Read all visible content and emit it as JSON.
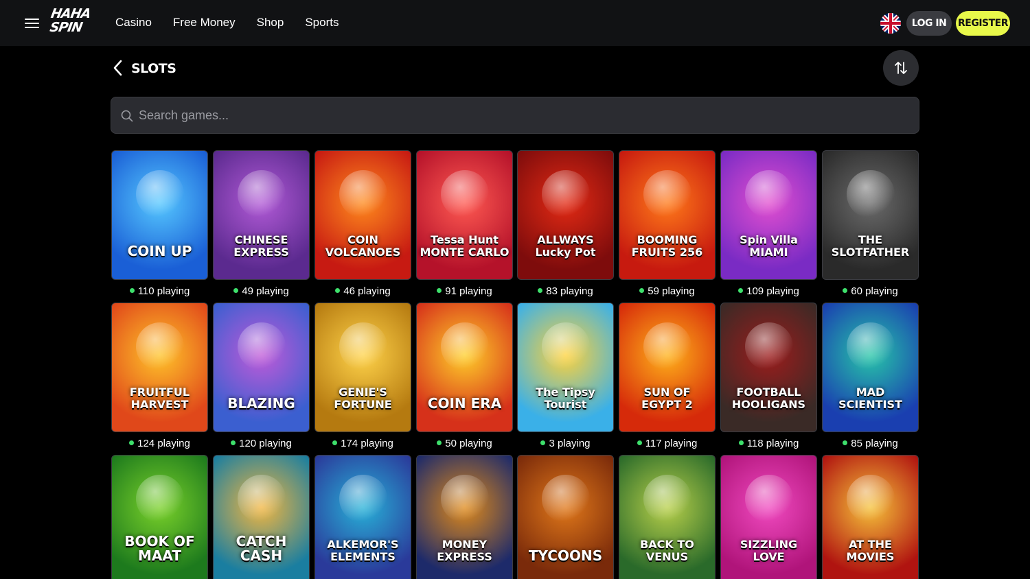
{
  "header": {
    "logo_line1": "HAHA",
    "logo_line2": "SPIN",
    "nav": [
      "Casino",
      "Free Money",
      "Shop",
      "Sports"
    ],
    "login_label": "LOG IN",
    "register_label": "REGISTER"
  },
  "page": {
    "title": "SLOTS"
  },
  "search": {
    "placeholder": "Search games..."
  },
  "games": [
    {
      "title": "COIN UP",
      "playing": "110 playing",
      "bg": "#1a5fd6",
      "bg2": "#56c8ff",
      "icon": "coin-up-thumb"
    },
    {
      "title": "CHINESE EXPRESS",
      "playing": "49 playing",
      "bg": "#5b2a8f",
      "bg2": "#b15ad6",
      "icon": "chinese-express-thumb"
    },
    {
      "title": "COIN VOLCANOES",
      "playing": "46 playing",
      "bg": "#c71a12",
      "bg2": "#ff8a1d",
      "icon": "coin-volcanoes-thumb"
    },
    {
      "title": "Tessa Hunt MONTE CARLO",
      "playing": "91 playing",
      "bg": "#b5122a",
      "bg2": "#ff5a52",
      "icon": "monte-carlo-thumb"
    },
    {
      "title": "ALLWAYS Lucky Pot",
      "playing": "83 playing",
      "bg": "#7e0c0c",
      "bg2": "#e32a14",
      "icon": "allways-lucky-pot-thumb"
    },
    {
      "title": "BOOMING FRUITS 256",
      "playing": "59 playing",
      "bg": "#c71a0f",
      "bg2": "#ff7a1a",
      "icon": "booming-fruits-thumb"
    },
    {
      "title": "Spin Villa MIAMI",
      "playing": "109 playing",
      "bg": "#7a2bc4",
      "bg2": "#e24fd0",
      "icon": "spin-villa-thumb"
    },
    {
      "title": "THE SLOTFATHER",
      "playing": "60 playing",
      "bg": "#2a2a2a",
      "bg2": "#6b6b6b",
      "icon": "slotfather-thumb"
    },
    {
      "title": "FRUITFUL HARVEST",
      "playing": "124 playing",
      "bg": "#e0481a",
      "bg2": "#ffc42a",
      "icon": "fruitful-harvest-thumb"
    },
    {
      "title": "BLAZING",
      "playing": "120 playing",
      "bg": "#3b5fd0",
      "bg2": "#c05ad8",
      "icon": "blazing-thumb"
    },
    {
      "title": "GENIE'S FORTUNE",
      "playing": "174 playing",
      "bg": "#b57a10",
      "bg2": "#ffd34a",
      "icon": "genies-fortune-thumb"
    },
    {
      "title": "COIN ERA",
      "playing": "50 playing",
      "bg": "#d6311a",
      "bg2": "#ffcf2a",
      "icon": "coin-era-thumb"
    },
    {
      "title": "The Tipsy Tourist",
      "playing": "3 playing",
      "bg": "#3ab0e8",
      "bg2": "#ffd23a",
      "icon": "tipsy-tourist-thumb"
    },
    {
      "title": "SUN OF EGYPT 2",
      "playing": "117 playing",
      "bg": "#d62a0a",
      "bg2": "#ffb21a",
      "icon": "sun-of-egypt-thumb"
    },
    {
      "title": "FOOTBALL HOOLIGANS",
      "playing": "118 playing",
      "bg": "#3a2a26",
      "bg2": "#9c1c1c",
      "icon": "football-hooligans-thumb"
    },
    {
      "title": "MAD SCIENTIST",
      "playing": "85 playing",
      "bg": "#1a3fb0",
      "bg2": "#27c6a8",
      "icon": "mad-scientist-thumb"
    },
    {
      "title": "BOOK OF MAAT",
      "playing": "",
      "bg": "#1d7a1d",
      "bg2": "#7ad12a",
      "icon": "book-of-maat-thumb"
    },
    {
      "title": "CATCH CASH",
      "playing": "",
      "bg": "#1a7ea0",
      "bg2": "#f2b640",
      "icon": "catch-cash-thumb"
    },
    {
      "title": "ALKEMOR'S ELEMENTS",
      "playing": "",
      "bg": "#2a3a9a",
      "bg2": "#28b2d8",
      "icon": "alkemors-elements-thumb"
    },
    {
      "title": "MONEY EXPRESS",
      "playing": "",
      "bg": "#1d2a6a",
      "bg2": "#e08a1a",
      "icon": "money-express-thumb"
    },
    {
      "title": "TYCOONS",
      "playing": "",
      "bg": "#7a2a0a",
      "bg2": "#e0781a",
      "icon": "tycoons-thumb"
    },
    {
      "title": "BACK TO VENUS",
      "playing": "",
      "bg": "#2a6a2a",
      "bg2": "#b8d04a",
      "icon": "back-to-venus-thumb"
    },
    {
      "title": "SIZZLING LOVE",
      "playing": "",
      "bg": "#b0147a",
      "bg2": "#f04ac0",
      "icon": "sizzling-love-thumb"
    },
    {
      "title": "AT THE MOVIES",
      "playing": "",
      "bg": "#b01410",
      "bg2": "#f6c23a",
      "icon": "at-the-movies-thumb"
    }
  ]
}
